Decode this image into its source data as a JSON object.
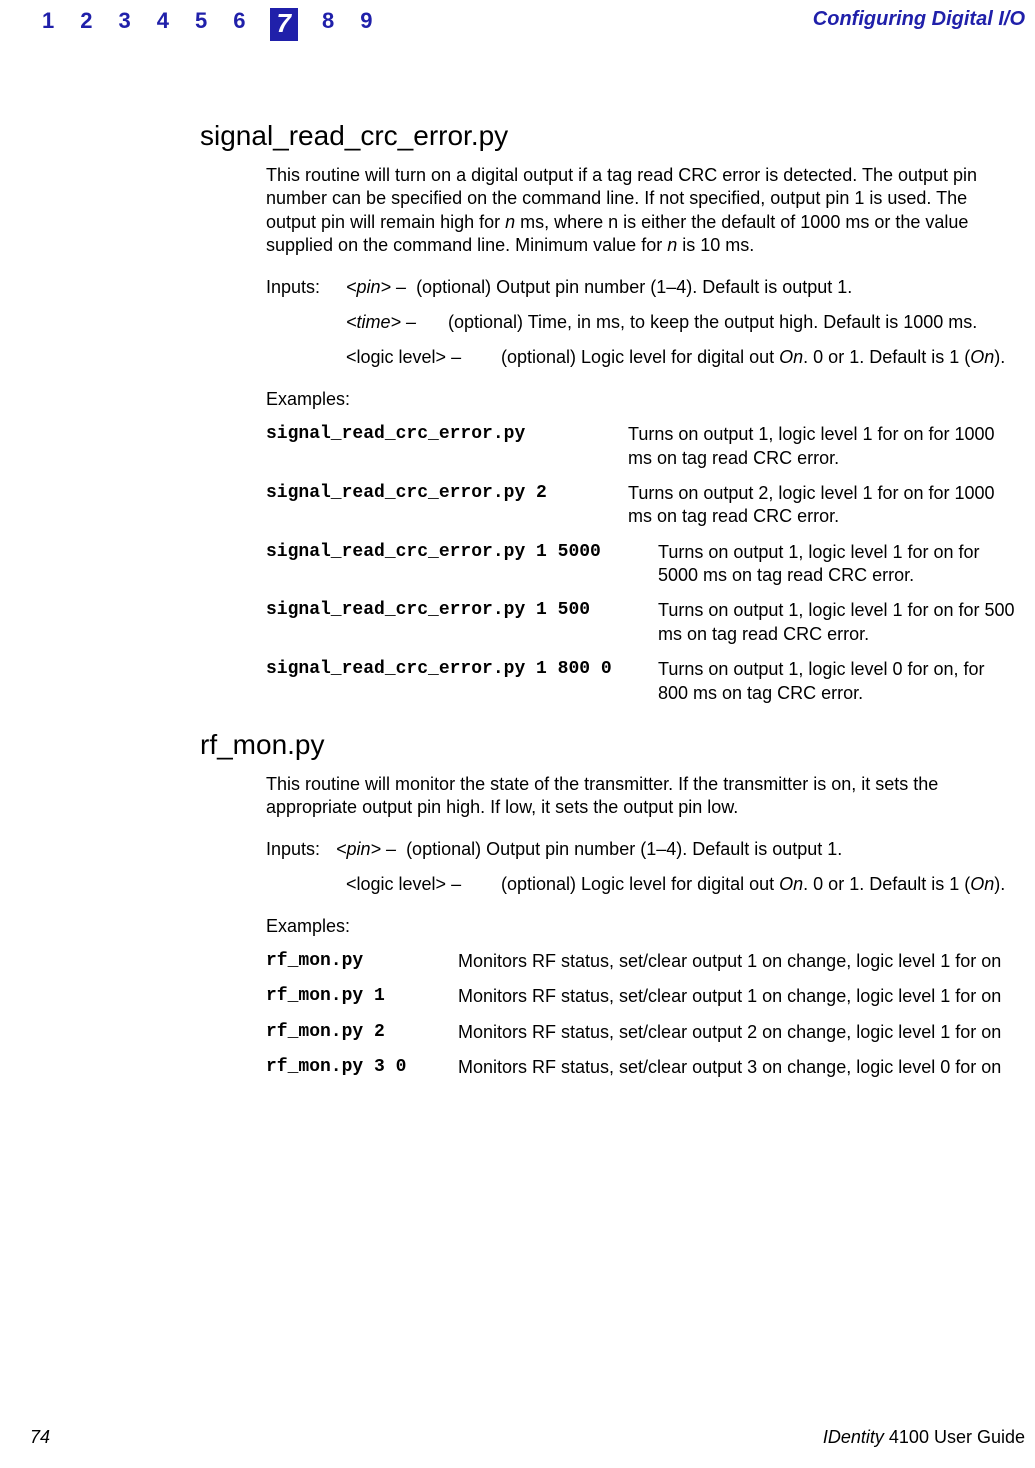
{
  "header": {
    "chapters": [
      "1",
      "2",
      "3",
      "4",
      "5",
      "6",
      "7",
      "8",
      "9"
    ],
    "active_index": 6,
    "title": "Configuring Digital I/O"
  },
  "section1": {
    "heading": "signal_read_crc_error.py",
    "intro_pre": "This routine will turn on a digital output if a tag read CRC error is detected. The output pin number can be specified on the command line. If not specified, output pin 1 is used. The output pin will remain high for ",
    "intro_n1": "n",
    "intro_mid": " ms, where n is either the default of 1000 ms or the value supplied on the command line. Minimum value for ",
    "intro_n2": "n",
    "intro_post": " is 10 ms.",
    "inputs_label": "Inputs:",
    "inputs": [
      {
        "param": "<pin> –",
        "desc": "(optional) Output pin number (1–4). Default is output 1.",
        "italic": true
      },
      {
        "param": "<time> –",
        "desc": "(optional) Time, in ms, to keep the output high. Default is 1000 ms.",
        "italic": true
      },
      {
        "param": "<logic level> –",
        "desc_pre": "(optional) Logic level for digital out ",
        "desc_on": "On",
        "desc_post": ". 0 or 1. Default is 1 (",
        "desc_on2": "On",
        "desc_post2": ").",
        "italic": false
      }
    ],
    "examples_label": "Examples:",
    "examples": [
      {
        "cmd": "signal_read_crc_error.py",
        "cmd_w": 350,
        "desc": "Turns on output 1, logic level 1 for on for 1000 ms on tag read CRC error."
      },
      {
        "cmd": "signal_read_crc_error.py 2",
        "cmd_w": 350,
        "desc": "Turns on output 2, logic level 1 for on for 1000 ms on tag read CRC error."
      },
      {
        "cmd": "signal_read_crc_error.py 1 5000",
        "cmd_w": 380,
        "desc": "Turns on output 1, logic level 1 for on for 5000 ms on tag read CRC error."
      },
      {
        "cmd": "signal_read_crc_error.py 1 500",
        "cmd_w": 380,
        "desc": "Turns on output 1, logic level 1 for on for 500 ms on tag read CRC error."
      },
      {
        "cmd": "signal_read_crc_error.py 1 800 0",
        "cmd_w": 380,
        "desc": "Turns on output 1, logic level 0 for on, for 800 ms on tag CRC error."
      }
    ]
  },
  "section2": {
    "heading": "rf_mon.py",
    "intro": "This routine will monitor the state of the transmitter.  If the transmitter is on, it sets the appropriate output pin high. If low, it sets the output pin low.",
    "inputs_label": "Inputs:",
    "inputs": [
      {
        "param": "<pin> –",
        "desc": "(optional) Output pin number (1–4). Default is output 1.",
        "italic": true
      },
      {
        "param": "<logic level> –",
        "desc_pre": "(optional) Logic level for digital out ",
        "desc_on": "On",
        "desc_post": ". 0 or 1. Default is 1 (",
        "desc_on2": "On",
        "desc_post2": ").",
        "italic": false
      }
    ],
    "examples_label": "Examples:",
    "examples": [
      {
        "cmd": "rf_mon.py",
        "cmd_w": 180,
        "desc": "Monitors RF status, set/clear output 1 on change, logic level 1 for on"
      },
      {
        "cmd": "rf_mon.py 1",
        "cmd_w": 180,
        "desc": "Monitors RF status, set/clear output 1 on change, logic level 1 for on"
      },
      {
        "cmd": "rf_mon.py 2",
        "cmd_w": 180,
        "desc": "Monitors RF status, set/clear output 2 on change, logic level 1 for on"
      },
      {
        "cmd": "rf_mon.py 3 0",
        "cmd_w": 180,
        "desc": "Monitors RF status, set/clear output 3 on change, logic level 0 for on"
      }
    ]
  },
  "footer": {
    "page": "74",
    "brand": "IDentity",
    "guide_rest": " 4100 User Guide"
  }
}
